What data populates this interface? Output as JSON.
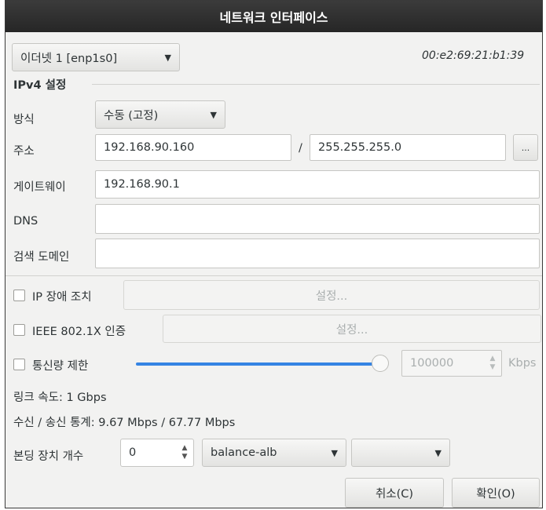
{
  "window": {
    "title": "네트워크 인터페이스"
  },
  "interface": {
    "selected": "이더넷 1 [enp1s0]",
    "mac": "00:e2:69:21:b1:39"
  },
  "ipv4": {
    "section_title": "IPv4 설정",
    "method_label": "방식",
    "method_value": "수동 (고정)",
    "address_label": "주소",
    "address_value": "192.168.90.160",
    "slash": "/",
    "netmask_value": "255.255.255.0",
    "more_button": "...",
    "gateway_label": "게이트웨이",
    "gateway_value": "192.168.90.1",
    "dns_label": "DNS",
    "dns_value": "",
    "search_label": "검색 도메인",
    "search_value": ""
  },
  "options": {
    "ip_failover_label": "IP 장애 조치",
    "ip_failover_button": "설정...",
    "ieee_label": "IEEE 802.1X 인증",
    "ieee_button": "설정...",
    "bandwidth_label": "통신량 제한",
    "bandwidth_value": "100000",
    "bandwidth_unit": "Kbps"
  },
  "status": {
    "link_speed": "링크 속도: 1 Gbps",
    "traffic": "수신 / 송신 통계: 9.67 Mbps / 67.77 Mbps"
  },
  "bonding": {
    "label": "본딩 장치 개수",
    "count": "0",
    "mode": "balance-alb",
    "secondary": ""
  },
  "buttons": {
    "cancel": "취소(C)",
    "ok": "확인(O)"
  },
  "colors": {
    "titlebar": "#2e2e2e",
    "slider_fill": "#3584e4",
    "background": "#f2f2f1"
  }
}
